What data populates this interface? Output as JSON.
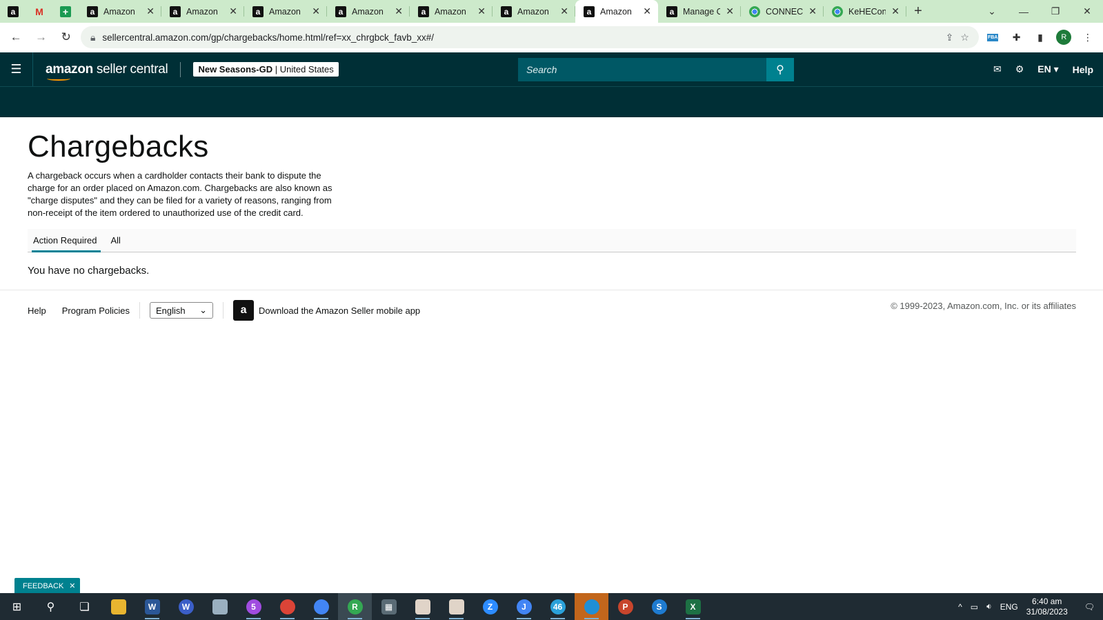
{
  "browser": {
    "tabs": [
      {
        "title": "Amazon",
        "favicon": "amazon-icon"
      },
      {
        "title": "Amazon",
        "favicon": "amazon-icon"
      },
      {
        "title": "Amazon",
        "favicon": "amazon-icon"
      },
      {
        "title": "Amazon",
        "favicon": "amazon-icon"
      },
      {
        "title": "Amazon",
        "favicon": "amazon-icon"
      },
      {
        "title": "Amazon",
        "favicon": "amazon-icon"
      },
      {
        "title": "Amazon",
        "favicon": "amazon-icon",
        "active": true
      },
      {
        "title": "Manage C",
        "favicon": "amazon-icon"
      },
      {
        "title": "CONNECT",
        "favicon": "chrome-icon"
      },
      {
        "title": "KeHEConn",
        "favicon": "chrome-icon"
      }
    ],
    "url": "sellercentral.amazon.com/gp/chargebacks/home.html/ref=xx_chrgbck_favb_xx#/",
    "profile_initial": "R",
    "fba_badge": "FBA"
  },
  "header": {
    "logo_brand": "amazon",
    "logo_product": " seller central",
    "account_name": "New Seasons-GD",
    "account_sep": " | ",
    "account_region": "United States",
    "search_placeholder": "Search",
    "language": "EN",
    "help": "Help"
  },
  "page": {
    "title": "Chargebacks",
    "description": "A chargeback occurs when a cardholder contacts their bank to dispute the charge for an order placed on Amazon.com. Chargebacks are also known as \"charge disputes\" and they can be filed for a variety of reasons, ranging from non-receipt of the item ordered to unauthorized use of the credit card.",
    "tabs": [
      {
        "label": "Action Required",
        "selected": true
      },
      {
        "label": "All",
        "selected": false
      }
    ],
    "empty_message": "You have no chargebacks."
  },
  "footer": {
    "help": "Help",
    "program_policies": "Program Policies",
    "language_selected": "English",
    "app_download": "Download the Amazon Seller mobile app",
    "copyright": "© 1999-2023, Amazon.com, Inc. or its affiliates"
  },
  "feedback": {
    "label": "FEEDBACK"
  },
  "taskbar": {
    "language": "ENG",
    "time": "6:40 am",
    "date": "31/08/2023",
    "badges": {
      "messenger": "5",
      "telegram": "46",
      "chrome_profile_j": "J",
      "chrome_profile_r": "R"
    }
  },
  "colors": {
    "header_bg": "#002f36",
    "search_bg": "#005865",
    "search_button": "#00818f",
    "tab_underline": "#008296",
    "tabstrip_bg": "#cdeacb"
  }
}
